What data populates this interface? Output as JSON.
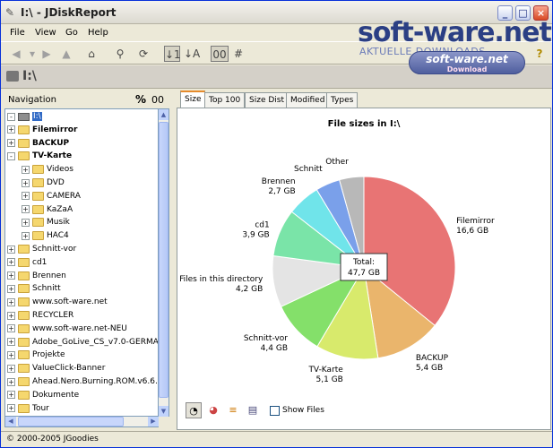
{
  "window": {
    "title": "I:\\ - JDiskReport",
    "controls": {
      "minimize": "_",
      "maximize": "□",
      "close": "×"
    }
  },
  "watermark": {
    "title": "soft-ware.net",
    "subtitle": "AKTUELLE DOWNLOADS",
    "badge_title": "soft-ware.net",
    "badge_sub": "Download"
  },
  "menu": {
    "file": "File",
    "view": "View",
    "go": "Go",
    "help": "Help"
  },
  "toolbar": {
    "sort_size": "↓1",
    "sort_name": "↓A",
    "count_mode": "00",
    "hash_mode": "#",
    "help": "?"
  },
  "path": {
    "current": "I:\\"
  },
  "navigation": {
    "title": "Navigation",
    "percent": "%",
    "count": "00",
    "tree": [
      {
        "label": "I:\\",
        "level": 0,
        "expander": "-",
        "type": "drive",
        "selected": true,
        "bold": false
      },
      {
        "label": "Filemirror",
        "level": 0,
        "expander": "+",
        "type": "folder",
        "bold": true
      },
      {
        "label": "BACKUP",
        "level": 0,
        "expander": "+",
        "type": "folder",
        "bold": true
      },
      {
        "label": "TV-Karte",
        "level": 0,
        "expander": "-",
        "type": "folder",
        "bold": true
      },
      {
        "label": "Videos",
        "level": 1,
        "expander": "+",
        "type": "folder"
      },
      {
        "label": "DVD",
        "level": 1,
        "expander": "+",
        "type": "folder"
      },
      {
        "label": "CAMERA",
        "level": 1,
        "expander": "+",
        "type": "folder"
      },
      {
        "label": "KaZaA",
        "level": 1,
        "expander": "+",
        "type": "folder"
      },
      {
        "label": "Musik",
        "level": 1,
        "expander": "+",
        "type": "folder"
      },
      {
        "label": "HAC4",
        "level": 1,
        "expander": "+",
        "type": "folder"
      },
      {
        "label": "Schnitt-vor",
        "level": 0,
        "expander": "+",
        "type": "folder"
      },
      {
        "label": "cd1",
        "level": 0,
        "expander": "+",
        "type": "folder"
      },
      {
        "label": "Brennen",
        "level": 0,
        "expander": "+",
        "type": "folder"
      },
      {
        "label": "Schnitt",
        "level": 0,
        "expander": "+",
        "type": "folder"
      },
      {
        "label": "www.soft-ware.net",
        "level": 0,
        "expander": "+",
        "type": "folder"
      },
      {
        "label": "RECYCLER",
        "level": 0,
        "expander": "+",
        "type": "folder"
      },
      {
        "label": "www.soft-ware.net-NEU",
        "level": 0,
        "expander": "+",
        "type": "folder"
      },
      {
        "label": "Adobe_GoLive_CS_v7.0-GERMA",
        "level": 0,
        "expander": "+",
        "type": "folder"
      },
      {
        "label": "Projekte",
        "level": 0,
        "expander": "+",
        "type": "folder"
      },
      {
        "label": "ValueClick-Banner",
        "level": 0,
        "expander": "+",
        "type": "folder"
      },
      {
        "label": "Ahead.Nero.Burning.ROM.v6.6.",
        "level": 0,
        "expander": "+",
        "type": "folder"
      },
      {
        "label": "Dokumente",
        "level": 0,
        "expander": "+",
        "type": "folder"
      },
      {
        "label": "Tour",
        "level": 0,
        "expander": "+",
        "type": "folder"
      }
    ]
  },
  "tabs": [
    "Size",
    "Top 100",
    "Size Dist",
    "Modified",
    "Types"
  ],
  "active_tab": "Size",
  "chart_data": {
    "type": "pie",
    "title": "File sizes in I:\\",
    "total_label": "Total:",
    "total_value": "47,7 GB",
    "slices": [
      {
        "name": "Filemirror",
        "value": 16.6,
        "label": "16,6 GB",
        "color": "#e87474"
      },
      {
        "name": "BACKUP",
        "value": 5.4,
        "label": "5,4 GB",
        "color": "#eab56c"
      },
      {
        "name": "TV-Karte",
        "value": 5.1,
        "label": "5,1 GB",
        "color": "#d8ea6c"
      },
      {
        "name": "Schnitt-vor",
        "value": 4.4,
        "label": "4,4 GB",
        "color": "#84e06a"
      },
      {
        "name": "Files in this directory",
        "value": 4.2,
        "label": "4,2 GB",
        "color": "#e4e4e4"
      },
      {
        "name": "cd1",
        "value": 3.9,
        "label": "3,9 GB",
        "color": "#7ae4a8"
      },
      {
        "name": "Brennen",
        "value": 2.7,
        "label": "2,7 GB",
        "color": "#70e4ea"
      },
      {
        "name": "Schnitt",
        "value": 2.0,
        "label": "",
        "color": "#7aa0ea"
      },
      {
        "name": "Other",
        "value": 2.0,
        "label": "",
        "color": "#b8b8b8"
      }
    ]
  },
  "view_options": {
    "show_files": "Show Files"
  },
  "status": {
    "text": "© 2000-2005 JGoodies"
  }
}
